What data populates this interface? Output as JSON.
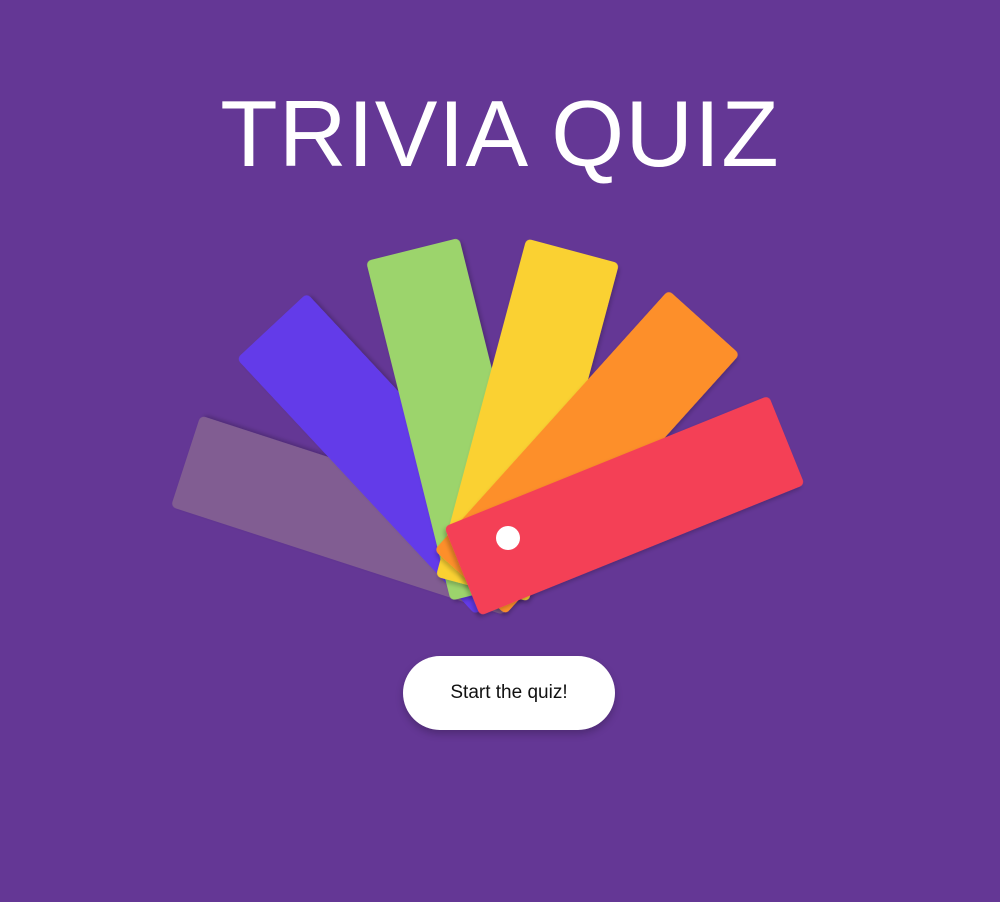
{
  "title": "TRIVIA QUIZ",
  "start_button_label": "Start the quiz!",
  "fan_colors": {
    "muted_purple": "#815D92",
    "blue_violet": "#633BE9",
    "green": "#9CD46C",
    "yellow": "#FAD131",
    "orange": "#FD8F2A",
    "red": "#F44157"
  },
  "background_color": "#643795"
}
